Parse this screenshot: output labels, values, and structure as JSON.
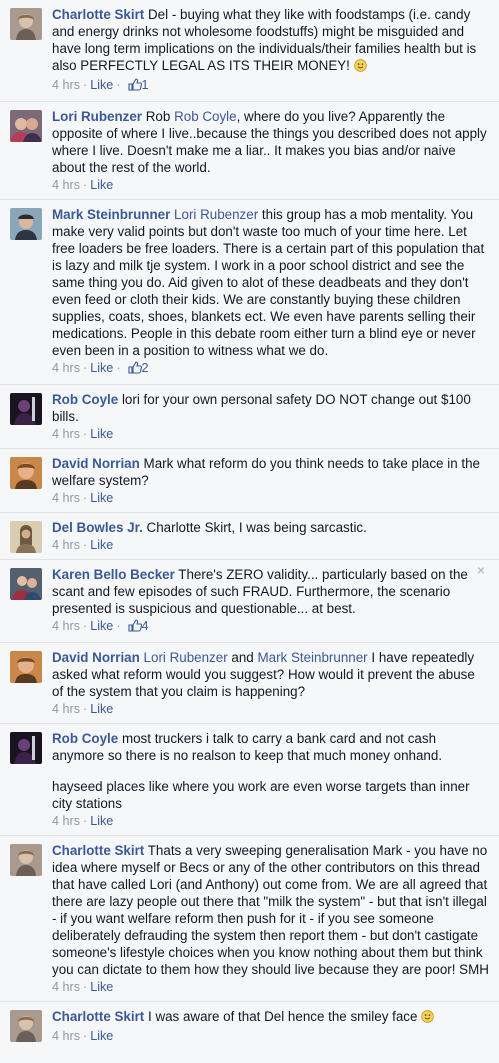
{
  "comments": [
    {
      "author": "Charlotte Skirt",
      "text": "Del - buying what they like with foodstamps (i.e. candy and energy drinks not wholesome foodstuffs) might be misguided and have long term implications on the individuals/their families health but is also PERFECTLY LEGAL AS ITS THEIR MONEY!",
      "time": "4 hrs",
      "like": "Like",
      "likes": "1"
    },
    {
      "author": "Lori Rubenzer",
      "text_prefix": "Rob",
      "mention": "Rob Coyle",
      "text": ", where do you live? Apparently the opposite of where I live..because the things you described does not apply where I live. Doesn't make me a liar.. It makes you bias and/or naive about the rest of the world.",
      "time": "4 hrs",
      "like": "Like"
    },
    {
      "author": "Mark Steinbrunner",
      "mention": "Lori Rubenzer",
      "text": "this group has a mob mentality. You make very valid points but don't waste too much of your time here. Let free loaders be free loaders. There is a certain part of this population that is lazy and milk tje system. I work in a poor school district and see the same thing you do. Aid given to alot of these deadbeats and they don't even feed or cloth their kids. We are constantly buying these children supplies, coats, shoes, blankets ect. We even have parents selling their medications. People in this debate room either turn a blind eye or never even been in a position to witness what we do.",
      "time": "4 hrs",
      "like": "Like",
      "likes": "2"
    },
    {
      "author": "Rob Coyle",
      "text": "lori for your own personal safety DO NOT change out $100 bills.",
      "time": "4 hrs",
      "like": "Like"
    },
    {
      "author": "David Norrian",
      "text": "Mark what reform do you think needs to take place in the welfare system?",
      "time": "4 hrs",
      "like": "Like"
    },
    {
      "author": "Del Bowles Jr.",
      "text": "Charlotte Skirt, I was being sarcastic.",
      "time": "4 hrs",
      "like": "Like"
    },
    {
      "author": "Karen Bello Becker",
      "text": "There's ZERO validity... particularly based on the scant and few episodes of such FRAUD. Furthermore, the scenario presented is suspicious and questionable... at best.",
      "time": "4 hrs",
      "like": "Like",
      "likes": "4",
      "close": "×"
    },
    {
      "author": "David Norrian",
      "mention": "Lori Rubenzer",
      "and": "and",
      "mention2": "Mark Steinbrunner",
      "text": "I have repeatedly asked what reform would you suggest? How would it prevent the abuse of the system that you claim is happening?",
      "time": "4 hrs",
      "like": "Like"
    },
    {
      "author": "Rob Coyle",
      "text": "most truckers i talk to carry a bank card and not cash anymore so there is no realson to keep that much money onhand.",
      "text2": "hayseed places like where you work are even worse targets than inner city stations",
      "time": "4 hrs",
      "like": "Like"
    },
    {
      "author": "Charlotte Skirt",
      "text": "Thats a very sweeping generalisation Mark - you have no idea where myself or Becs or any of the other contributors on this thread that have called Lori (and Anthony) out come from. We are all agreed that there are lazy people out there that \"milk the system\" - but that isn't illegal - if you want welfare reform then push for it - if you see someone deliberately defrauding the system then report them - but don't castigate someone's lifestyle choices when you know nothing about them but think you can dictate to them how they should live because they are poor! SMH",
      "time": "4 hrs",
      "like": "Like"
    },
    {
      "author": "Charlotte Skirt",
      "text": "I was aware of that Del hence the smiley face",
      "time": "4 hrs",
      "like": "Like"
    }
  ],
  "dot": "·",
  "colors": {
    "link": "#3b5998",
    "meta": "#9197a3",
    "background": "#f6f7f9"
  }
}
